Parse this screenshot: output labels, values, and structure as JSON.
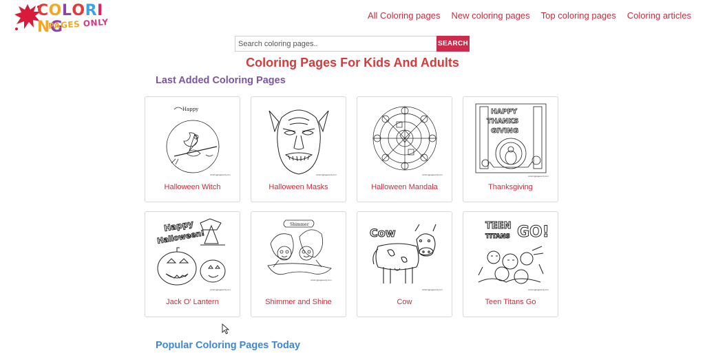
{
  "logo": {
    "letters": [
      "C",
      "O",
      "L",
      "O",
      "R",
      "I",
      "N",
      "G"
    ],
    "letter_colors": [
      "#e53935",
      "#f5a623",
      "#8e44ad",
      "#e53935",
      "#3ba3e0",
      "#e91e63",
      "#f5a623",
      "#8e44ad"
    ],
    "sub_pages": "PAGES",
    "sub_only": "ONLY",
    "splash_color": "#d81b3c"
  },
  "nav": {
    "items": [
      {
        "label": "All Coloring pages",
        "name": "nav-all-coloring-pages"
      },
      {
        "label": "New coloring pages",
        "name": "nav-new-coloring-pages"
      },
      {
        "label": "Top coloring pages",
        "name": "nav-top-coloring-pages"
      },
      {
        "label": "Coloring articles",
        "name": "nav-coloring-articles"
      }
    ]
  },
  "search": {
    "placeholder": "Search coloring pages..",
    "value": "",
    "button_label": "SEARCH"
  },
  "main_title": "Coloring Pages For Kids And Adults",
  "sections": {
    "last_added": "Last Added Coloring Pages",
    "popular": "Popular Coloring Pages Today"
  },
  "cards": [
    {
      "label": "Halloween Witch",
      "art": "witch"
    },
    {
      "label": "Halloween Masks",
      "art": "mask"
    },
    {
      "label": "Halloween Mandala",
      "art": "mandala"
    },
    {
      "label": "Thanksgiving",
      "art": "thanksgiving"
    },
    {
      "label": "Jack O' Lantern",
      "art": "pumpkin"
    },
    {
      "label": "Shimmer and Shine",
      "art": "genies"
    },
    {
      "label": "Cow",
      "art": "cow"
    },
    {
      "label": "Teen Titans Go",
      "art": "titans"
    }
  ],
  "colors": {
    "accent_red": "#cc2b3c",
    "title_red": "#d63a3a",
    "section_purple": "#7b55a4",
    "section_blue": "#3d86d4",
    "search_button": "#cc2b4c"
  }
}
